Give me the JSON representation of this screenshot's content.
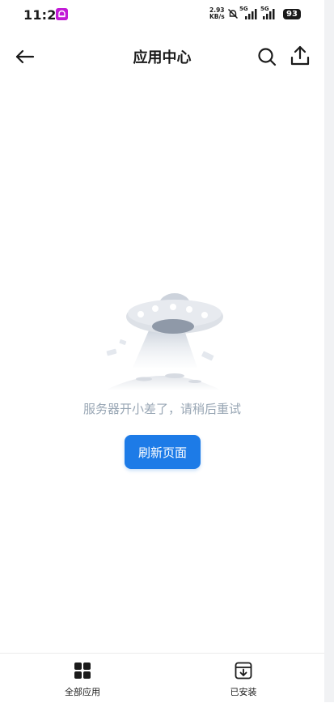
{
  "status_bar": {
    "time": "11:27",
    "net_speed_value": "2.93",
    "net_speed_unit": "KB/s",
    "signal_1": "5G",
    "signal_2": "5G",
    "battery": "93",
    "icons": [
      "notification-app-icon",
      "mute-icon",
      "signal-icon",
      "signal-icon",
      "battery-icon"
    ]
  },
  "header": {
    "title": "应用中心",
    "icons": [
      "back-arrow-icon",
      "search-icon",
      "share-icon"
    ]
  },
  "empty_state": {
    "illustration": "ufo-illustration",
    "message": "服务器开小差了，请稍后重试",
    "refresh_label": "刷新页面"
  },
  "bottom_nav": {
    "items": [
      {
        "label": "全部应用",
        "icon": "grid-icon"
      },
      {
        "label": "已安装",
        "icon": "download-box-icon"
      }
    ]
  },
  "colors": {
    "accent": "#1d7be7",
    "message_text": "#98a6b4",
    "notification_app": "#c21ad6"
  }
}
